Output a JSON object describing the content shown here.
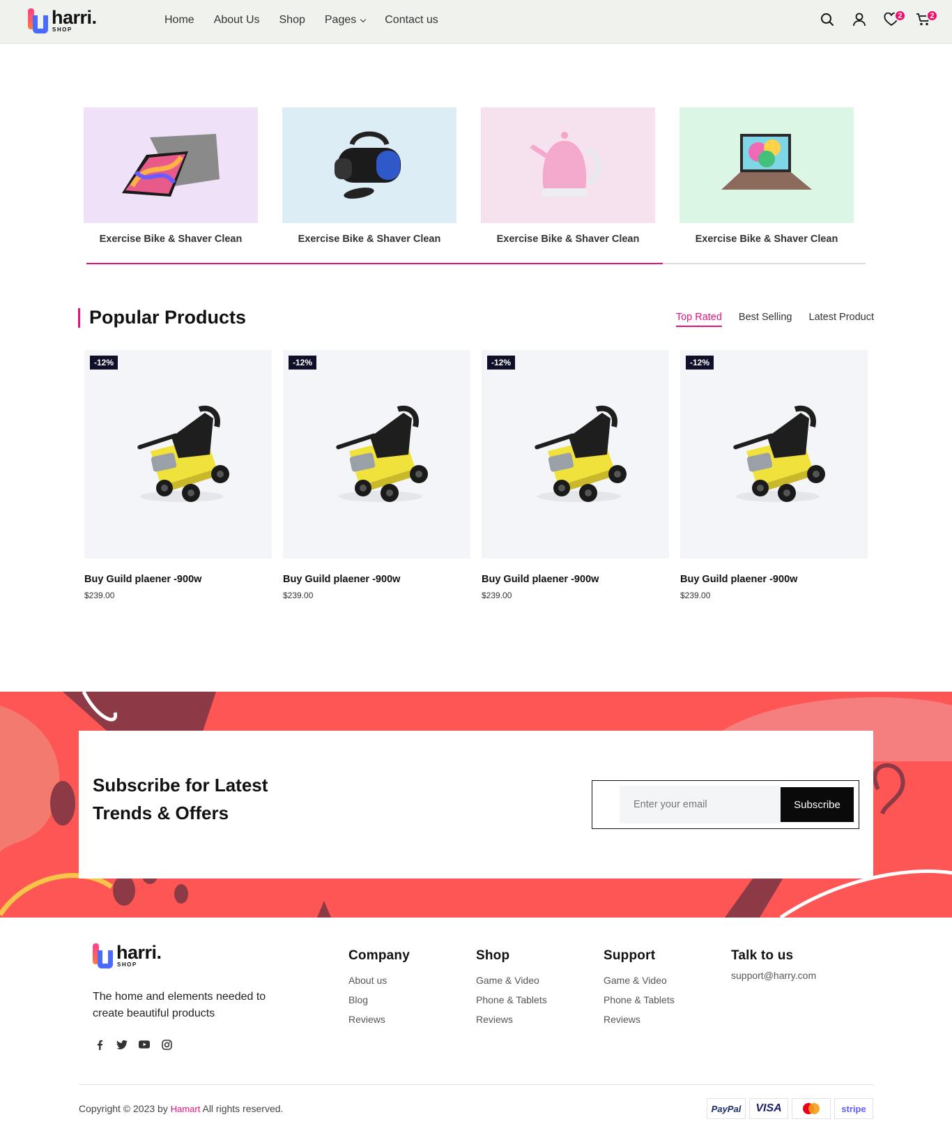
{
  "brand": {
    "name": "harri.",
    "tagline": "SHOP"
  },
  "nav": {
    "items": [
      "Home",
      "About Us",
      "Shop",
      "Pages",
      "Contact us"
    ]
  },
  "header": {
    "wishlist_count": "2",
    "cart_count": "2"
  },
  "categories": [
    {
      "label": "Exercise Bike & Shaver Clean",
      "image": "tablet",
      "bg": "#efe1f7"
    },
    {
      "label": "Exercise Bike & Shaver Clean",
      "image": "vr-headset",
      "bg": "#dcedf5"
    },
    {
      "label": "Exercise Bike & Shaver Clean",
      "image": "kettle",
      "bg": "#f6e1ef"
    },
    {
      "label": "Exercise Bike & Shaver Clean",
      "image": "laptop",
      "bg": "#dcf6e5"
    }
  ],
  "category_progress": 0.74,
  "popular": {
    "title": "Popular Products",
    "tabs": [
      "Top Rated",
      "Best Selling",
      "Latest Product"
    ],
    "active_tab": "Top Rated",
    "products": [
      {
        "badge": "-12%",
        "name": "Buy Guild plaener -900w",
        "price": "$239.00"
      },
      {
        "badge": "-12%",
        "name": "Buy Guild plaener -900w",
        "price": "$239.00"
      },
      {
        "badge": "-12%",
        "name": "Buy Guild plaener -900w",
        "price": "$239.00"
      },
      {
        "badge": "-12%",
        "name": "Buy Guild plaener -900w",
        "price": "$239.00"
      }
    ]
  },
  "subscribe": {
    "title_line1": "Subscribe for Latest",
    "title_line2": "Trends & Offers",
    "placeholder": "Enter your email",
    "button": "Subscribe"
  },
  "footer": {
    "about": "The home and elements needed to create beautiful products",
    "socials": [
      "facebook-icon",
      "twitter-icon",
      "youtube-icon",
      "instagram-icon"
    ],
    "columns": [
      {
        "title": "Company",
        "links": [
          "About us",
          "Blog",
          "Reviews"
        ]
      },
      {
        "title": "Shop",
        "links": [
          "Game & Video",
          "Phone & Tablets",
          "Reviews"
        ]
      },
      {
        "title": "Support",
        "links": [
          "Game & Video",
          "Phone & Tablets",
          "Reviews"
        ]
      },
      {
        "title": "Talk to us",
        "links": [
          "support@harry.com"
        ]
      }
    ],
    "copyright_prefix": "Copyright © 2023 by",
    "copyright_brand": "Hamart",
    "copyright_suffix": "All rights reserved.",
    "payments": [
      "PayPal",
      "VISA",
      "mastercard",
      "stripe"
    ]
  },
  "colors": {
    "accent": "#e8117a",
    "banner": "#fe5555",
    "header_bg": "#f0f2ee"
  }
}
